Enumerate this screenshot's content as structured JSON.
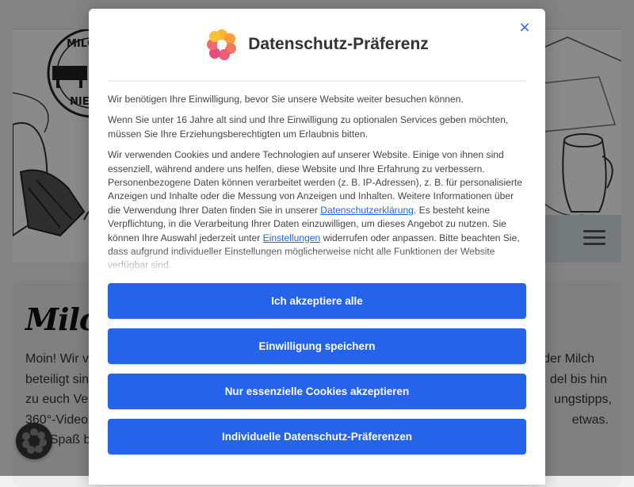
{
  "page": {
    "content_title": "Milch",
    "content_lines": [
      "Moin! Wir v",
      "beteiligt sin",
      "zu euch Ver",
      "360°-Video",
      "Viel Spaß b"
    ],
    "content_lines_right": [
      "der Milch",
      "del bis hin",
      "ungstipps,",
      "etwas."
    ]
  },
  "hero_badge": {
    "text_top": "MILC",
    "text_bottom": "NIEDER"
  },
  "modal": {
    "title": "Datenschutz-Präferenz",
    "close_icon": "×",
    "paragraph1": "Wir benötigen Ihre Einwilligung, bevor Sie unsere Website weiter besuchen können.",
    "paragraph2": "Wenn Sie unter 16 Jahre alt sind und Ihre Einwilligung zu optionalen Services geben möchten, müssen Sie Ihre Erziehungsberechtigten um Erlaubnis bitten.",
    "paragraph3_part1": "Wir verwenden Cookies und andere Technologien auf unserer Website. Einige von ihnen sind essenziell, während andere uns helfen, diese Website und Ihre Erfahrung zu verbessern. Personenbezogene Daten können verarbeitet werden (z. B. IP-Adressen), z. B. für personalisierte Anzeigen und Inhalte oder die Messung von Anzeigen und Inhalten. Weitere Informationen über die Verwendung Ihrer Daten finden Sie in unserer ",
    "privacy_link": "Datenschutzerklärung",
    "paragraph3_part2": ". Es besteht keine Verpflichtung, in die Verarbeitung Ihrer Daten einzuwilligen, um dieses Angebot zu nutzen. Sie können Ihre Auswahl jederzeit unter ",
    "settings_link": "Einstellungen",
    "paragraph3_part3": " widerrufen oder anpassen. Bitte beachten Sie, dass aufgrund individueller Einstellungen möglicherweise nicht alle Funktionen der Website verfügbar sind.",
    "btn_accept_all": "Ich akzeptiere alle",
    "btn_save": "Einwilligung speichern",
    "btn_essential": "Nur essenzielle Cookies akzeptieren",
    "btn_individual": "Individuelle Datenschutz-Präferenzen"
  },
  "colors": {
    "accent": "#2563eb",
    "overlay": "rgba(0,0,0,0.46)"
  },
  "icons": [
    "close-icon",
    "privacy-logo-icon",
    "hamburger-menu-icon",
    "privacy-settings-icon"
  ]
}
